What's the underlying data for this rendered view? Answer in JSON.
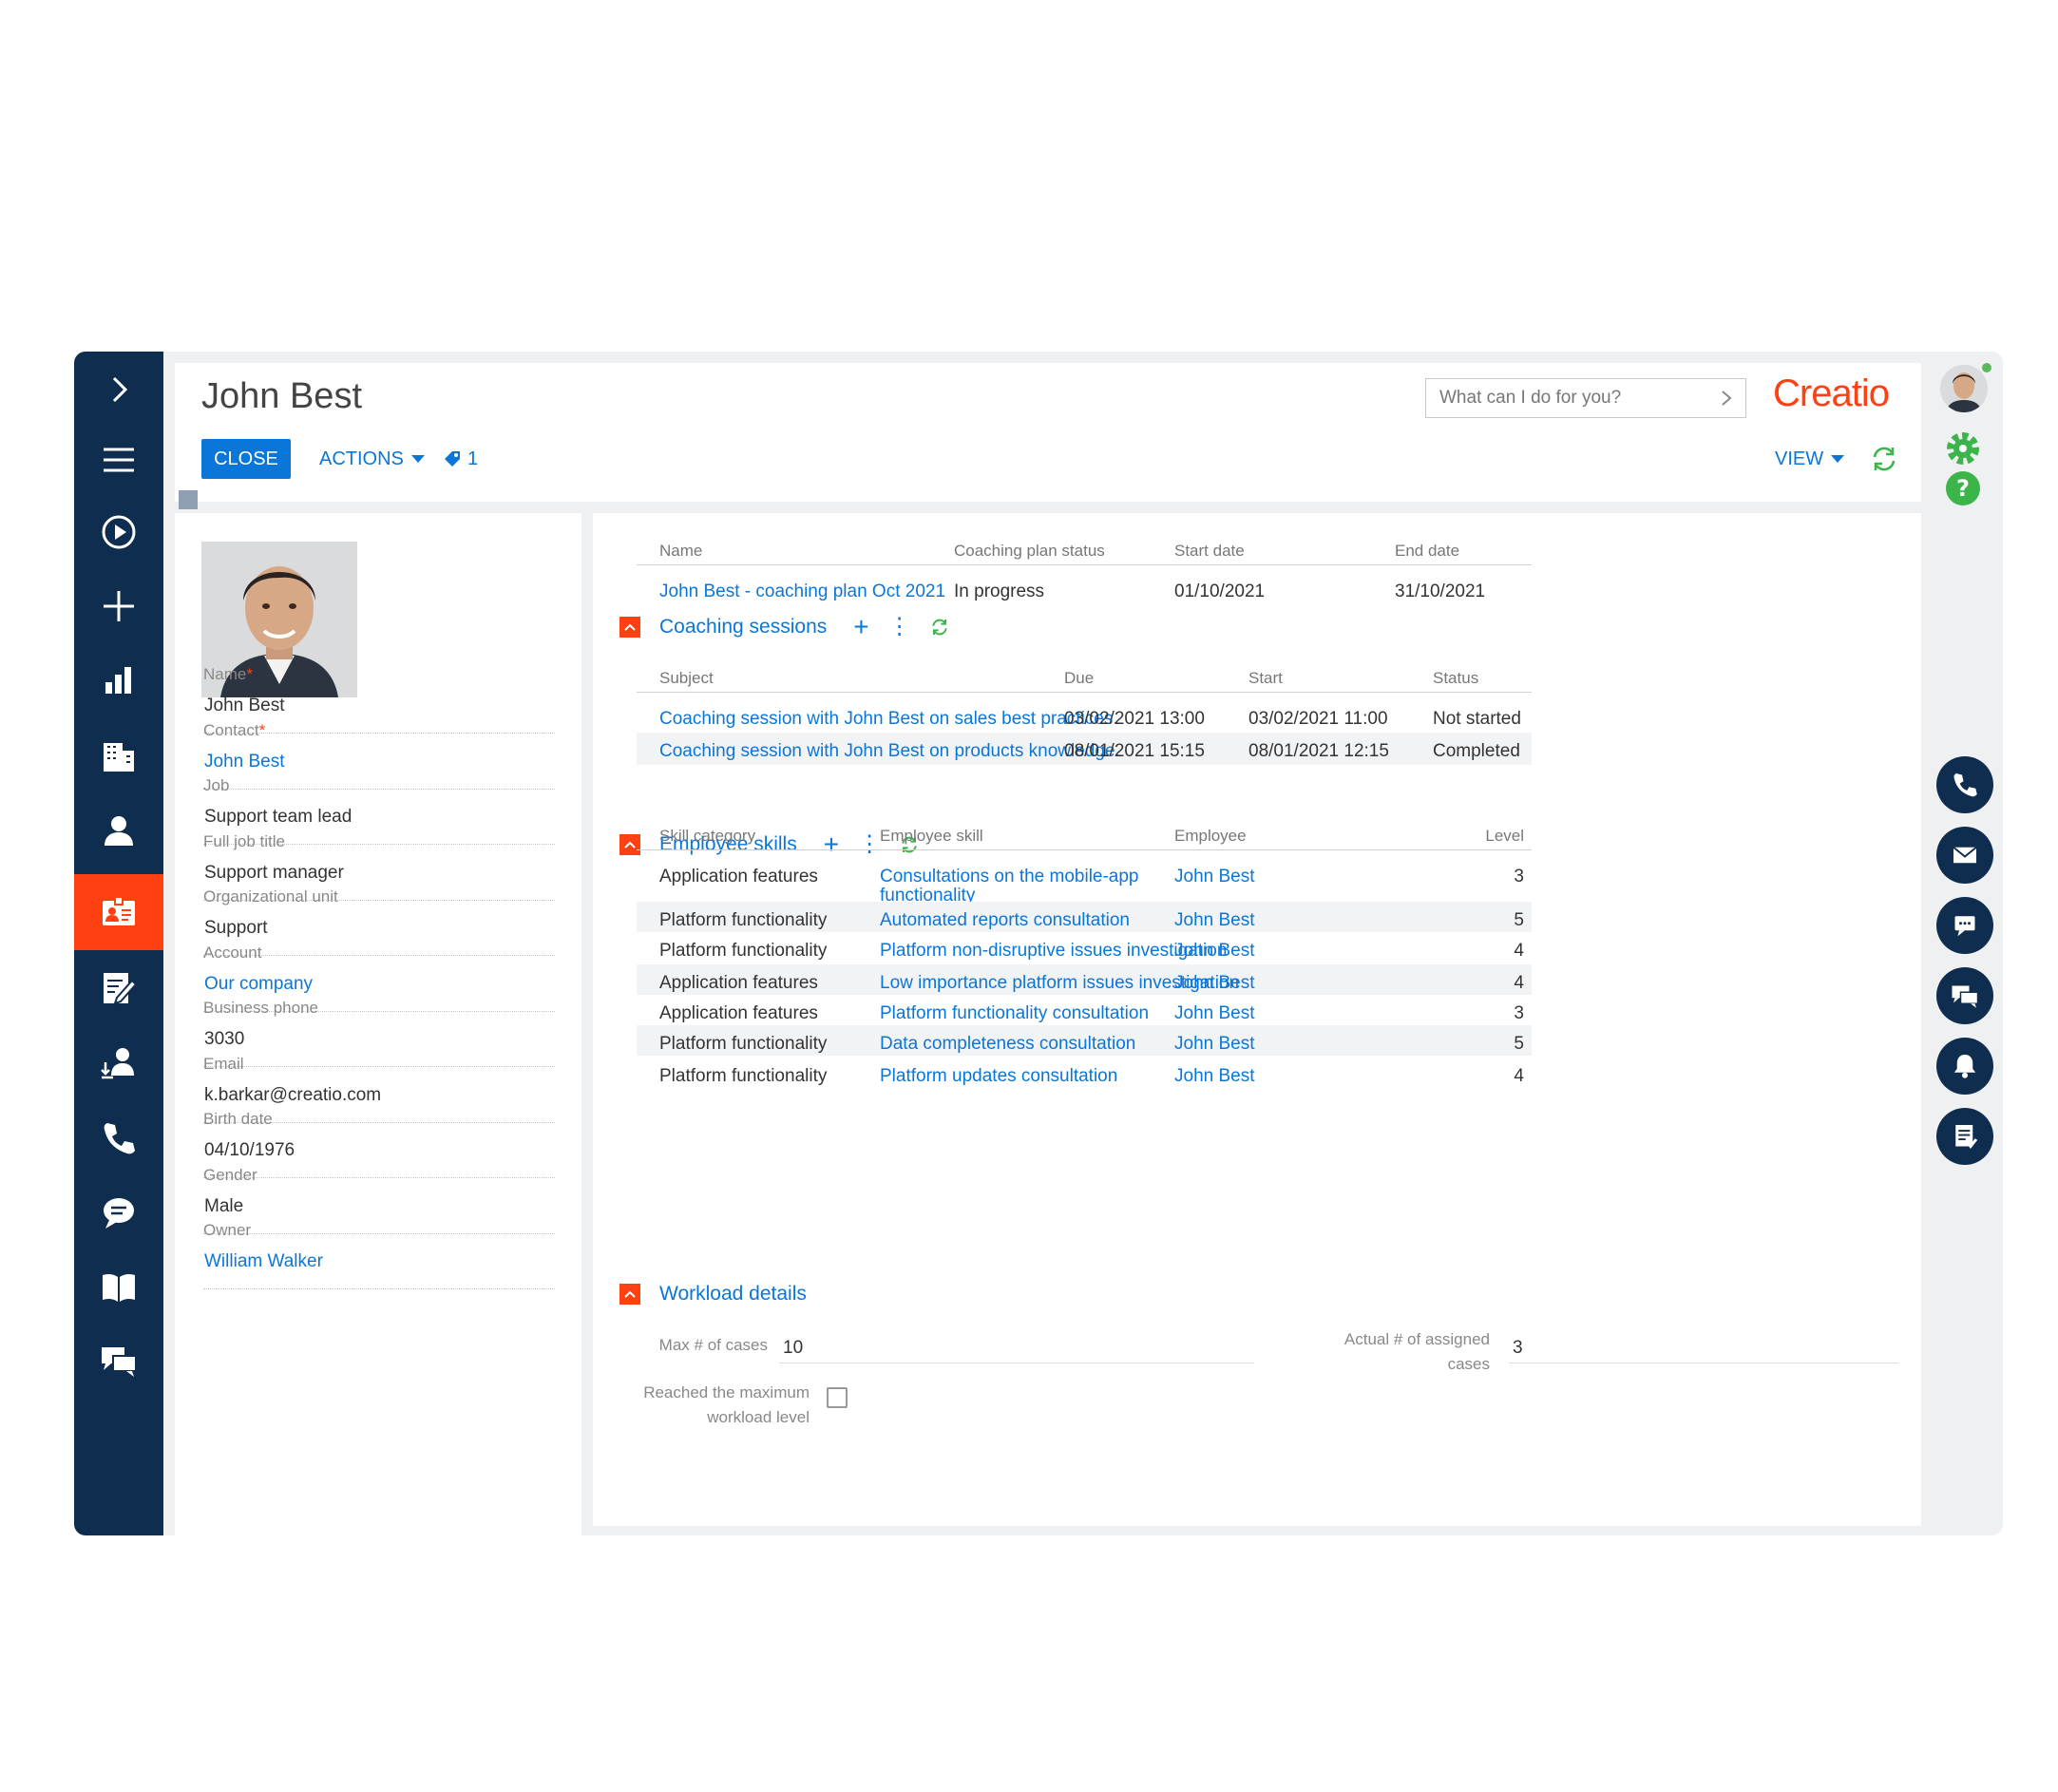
{
  "page": {
    "title": "John Best"
  },
  "toolbar": {
    "close_label": "CLOSE",
    "actions_label": "ACTIONS",
    "tag_count": "1",
    "view_label": "VIEW"
  },
  "search": {
    "placeholder": "What can I do for you?"
  },
  "brand": {
    "logo_text": "Creatio",
    "accent": "#ff4013",
    "link": "#0a76d8",
    "nav_bg": "#0f2d4e"
  },
  "left_nav": [
    "chevron-right-icon",
    "menu-icon",
    "play-icon",
    "plus-icon",
    "dashboard-icon",
    "accounts-icon",
    "contacts-icon",
    "employees-icon",
    "coaching-icon",
    "onboarding-icon",
    "calls-icon",
    "feed-icon",
    "knowledge-base-icon",
    "chats-icon"
  ],
  "profile": {
    "fields": [
      {
        "label": "Name",
        "required": "*",
        "value": "John Best",
        "link": false
      },
      {
        "label": "Contact",
        "required": "*",
        "value": "John Best",
        "link": true
      },
      {
        "label": "Job",
        "required": "",
        "value": "Support team lead",
        "link": false
      },
      {
        "label": "Full job title",
        "required": "",
        "value": "Support manager",
        "link": false
      },
      {
        "label": "Organizational unit",
        "required": "",
        "value": "Support",
        "link": false
      },
      {
        "label": "Account",
        "required": "",
        "value": "Our company",
        "link": true
      },
      {
        "label": "Business phone",
        "required": "",
        "value": "3030",
        "link": false
      },
      {
        "label": "Email",
        "required": "",
        "value": "k.barkar@creatio.com",
        "link": false
      },
      {
        "label": "Birth date",
        "required": "",
        "value": "04/10/1976",
        "link": false
      },
      {
        "label": "Gender",
        "required": "",
        "value": "Male",
        "link": false
      },
      {
        "label": "Owner",
        "required": "",
        "value": "William Walker",
        "link": true
      }
    ]
  },
  "coaching_plan": {
    "headers": [
      "Name",
      "Coaching plan status",
      "Start date",
      "End date"
    ],
    "rows": [
      [
        "John Best - coaching plan Oct 2021",
        "In progress",
        "01/10/2021",
        "31/10/2021"
      ]
    ]
  },
  "coaching_sessions": {
    "title": "Coaching sessions",
    "headers": [
      "Subject",
      "Due",
      "Start",
      "Status"
    ],
    "rows": [
      [
        "Coaching session with John Best on sales best practices.",
        "03/02/2021 13:00",
        "03/02/2021 11:00",
        "Not started"
      ],
      [
        "Coaching session with John Best on products knowledge.",
        "08/01/2021 15:15",
        "08/01/2021 12:15",
        "Completed"
      ]
    ]
  },
  "employee_skills": {
    "title": "Employee skills",
    "headers": [
      "Skill category",
      "Employee skill",
      "Employee",
      "Level"
    ],
    "rows": [
      [
        "Application features",
        "Consultations on the mobile-app",
        "functionality",
        "John Best",
        "3"
      ],
      [
        "Platform functionality",
        "Automated reports consultation",
        "",
        "John Best",
        "5"
      ],
      [
        "Platform functionality",
        "Platform non-disruptive issues investigation",
        "",
        "John Best",
        "4"
      ],
      [
        "Application features",
        "Low importance platform issues investigation",
        "",
        "John Best",
        "4"
      ],
      [
        "Application features",
        "Platform functionality consultation",
        "",
        "John Best",
        "3"
      ],
      [
        "Platform functionality",
        "Data completeness consultation",
        "",
        "John Best",
        "5"
      ],
      [
        "Platform functionality",
        "Platform updates consultation",
        "",
        "John Best",
        "4"
      ]
    ]
  },
  "workload": {
    "title": "Workload details",
    "max_cases_label": "Max # of cases",
    "max_cases_value": "10",
    "actual_label_1": "Actual # of assigned",
    "actual_label_2": "cases",
    "actual_value": "3",
    "reached_label_1": "Reached the maximum",
    "reached_label_2": "workload level",
    "reached_checked": false
  },
  "right_bar": [
    "user-avatar",
    "gear-icon",
    "help-icon",
    "phone-icon",
    "email-icon",
    "message-icon",
    "chats-icon",
    "notification-icon",
    "task-icon"
  ]
}
